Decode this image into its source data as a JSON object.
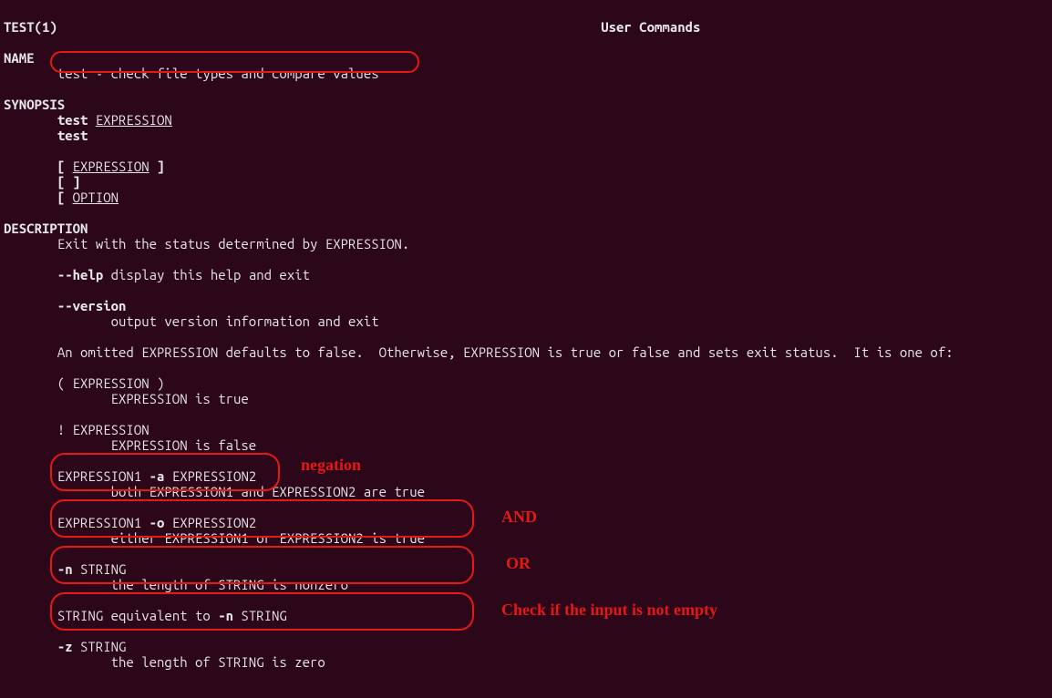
{
  "header_left": "TEST(1)",
  "header_center": "User Commands",
  "section_name": "NAME",
  "name_line": "test - check file types and compare values",
  "section_synopsis": "SYNOPSIS",
  "syn_test": "test",
  "syn_expr": "EXPRESSION",
  "syn_option": "OPTION",
  "bracket_open": "[ ",
  "bracket_close": " ]",
  "section_description": "DESCRIPTION",
  "desc_intro": "Exit with the status determined by EXPRESSION.",
  "help_flag": "--help",
  "help_text": " display this help and exit",
  "version_flag": "--version",
  "version_text": "output version information and exit",
  "desc_omitted": "An omitted EXPRESSION defaults to false.  Otherwise, EXPRESSION is true or false and sets exit status.  It is one of:",
  "paren_expr": "( EXPRESSION )",
  "paren_expr_desc": "EXPRESSION is true",
  "neg_expr": "! EXPRESSION",
  "neg_expr_desc": "EXPRESSION is false",
  "and_head_a": "EXPRESSION1 ",
  "and_flag": "-a",
  "and_head_b": " EXPRESSION2",
  "and_desc": "both EXPRESSION1 and EXPRESSION2 are true",
  "or_head_a": "EXPRESSION1 ",
  "or_flag": "-o",
  "or_head_b": " EXPRESSION2",
  "or_desc": "either EXPRESSION1 or EXPRESSION2 is true",
  "n_flag": "-n",
  "n_string": " STRING",
  "n_desc": "the length of STRING is nonzero",
  "equiv_a": "STRING equivalent to ",
  "equiv_b": "-n",
  "equiv_c": " STRING",
  "z_flag": "-z",
  "z_string": " STRING",
  "z_desc": "the length of STRING is zero",
  "annot_negation": "negation",
  "annot_and": "AND",
  "annot_or": "OR",
  "annot_nonempty": "Check if the input is not empty"
}
